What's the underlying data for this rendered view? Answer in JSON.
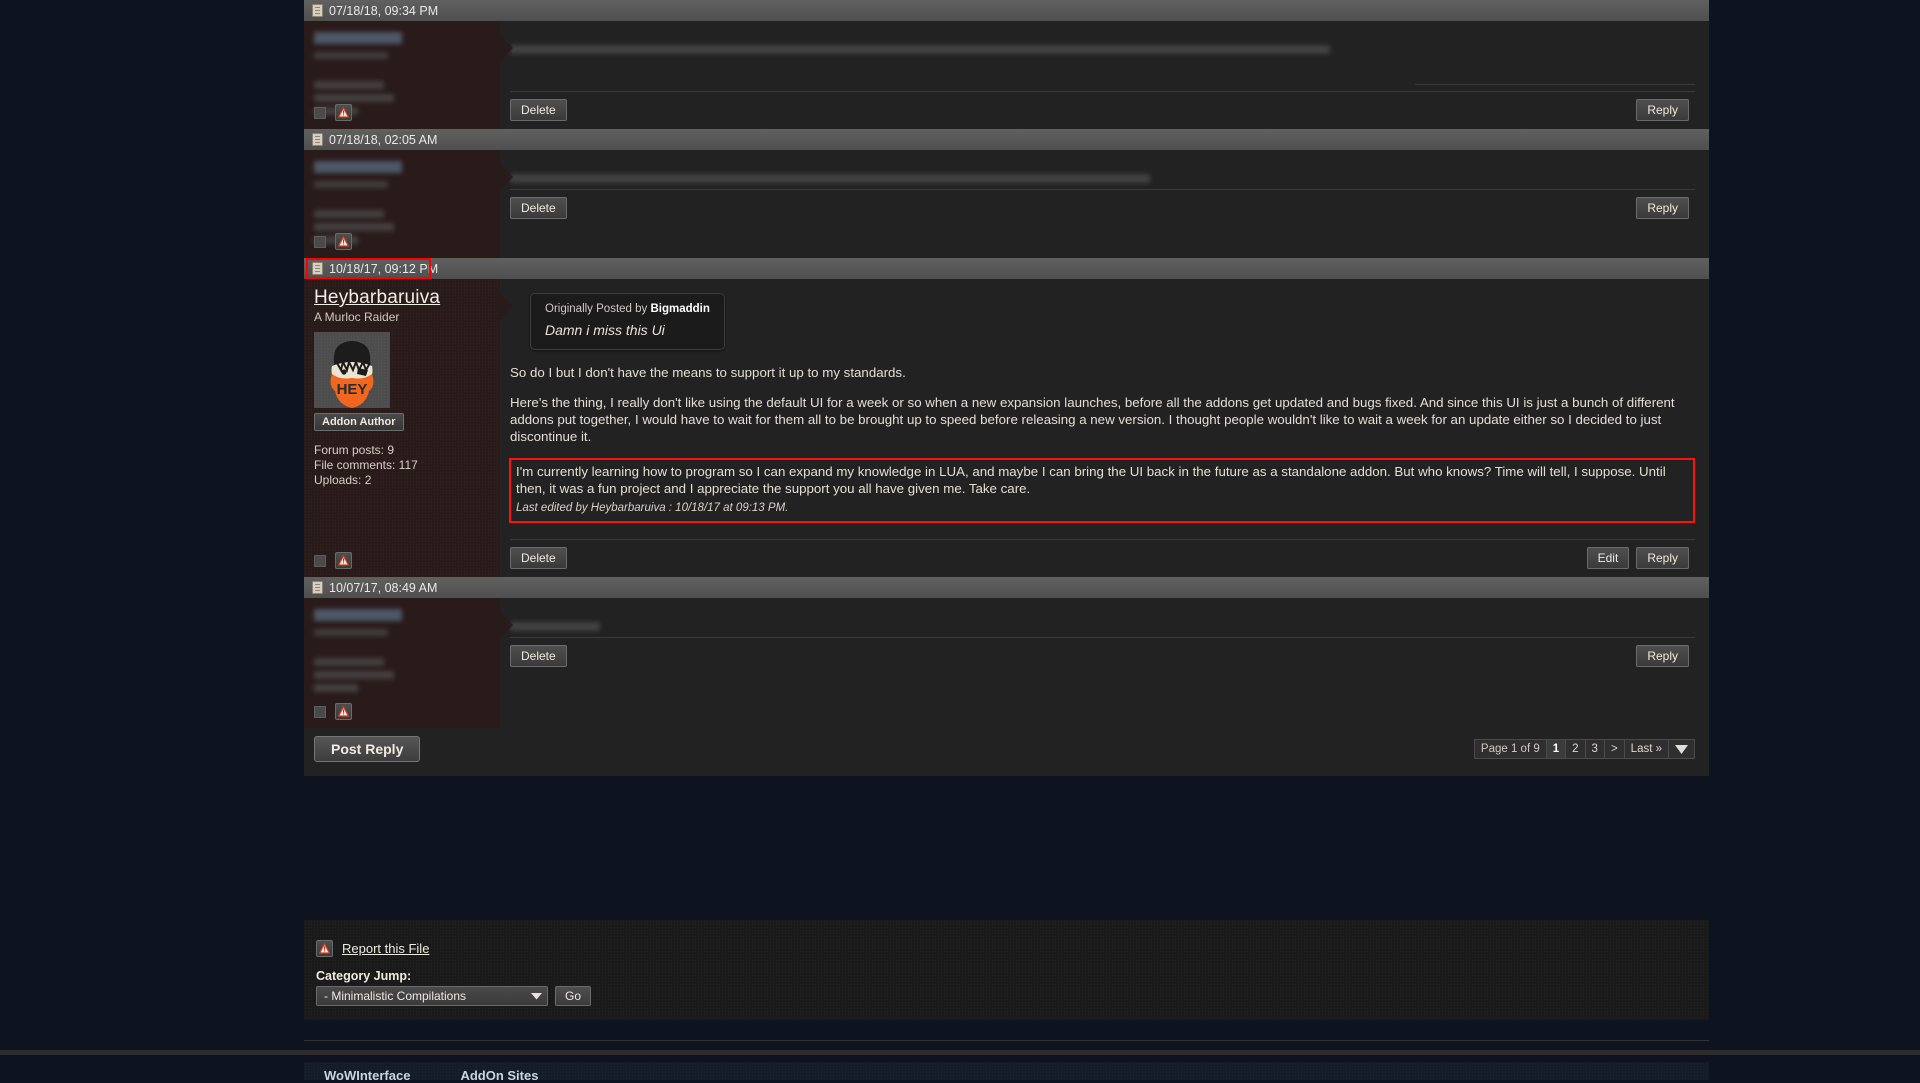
{
  "posts": [
    {
      "id": "post-1",
      "date": "07/18/18, 09:34 PM",
      "redacted": true,
      "delete_label": "Delete",
      "reply_label": "Reply"
    },
    {
      "id": "post-2",
      "date": "07/18/18, 02:05 AM",
      "redacted": true,
      "delete_label": "Delete",
      "reply_label": "Reply"
    },
    {
      "id": "post-3-highlighted",
      "date": "10/18/17, 09:12 PM",
      "redacted": false,
      "username": "Heybarbaruiva",
      "usertitle": "A Murloc Raider",
      "badge": "Addon Author",
      "stats": [
        "Forum posts: 9",
        "File comments: 117",
        "Uploads: 2"
      ],
      "quote": {
        "header_prefix": "Originally Posted by",
        "author": "Bigmaddin",
        "text": "Damn i miss this Ui"
      },
      "paragraphs": [
        "So do I but I don't have the means to support it up to my standards.",
        "Here's the thing, I really don't like using the default UI for a week or so when a new expansion launches, before all the addons get updated and bugs fixed. And since this UI is just a bunch of different addons put together, I would have to wait for them all to be brought up to speed before releasing a new version. I thought people wouldn't like to wait a week for an update either so I decided to just discontinue it."
      ],
      "highlighted_paragraph": "I'm currently learning how to program so I can expand my knowledge in LUA, and maybe I can bring the UI back in the future as a standalone addon. But who knows? Time will tell, I suppose. Until then, it was a fun project and I appreciate the support you all have given me. Take care.",
      "last_edited": "Last edited by Heybarbaruiva : 10/18/17 at 09:13 PM.",
      "delete_label": "Delete",
      "edit_label": "Edit",
      "reply_label": "Reply"
    },
    {
      "id": "post-4",
      "date": "10/07/17, 08:49 AM",
      "redacted": true,
      "delete_label": "Delete",
      "reply_label": "Reply"
    }
  ],
  "reply_bar": {
    "post_reply_label": "Post Reply",
    "pager": {
      "page_label": "Page 1 of 9",
      "pages": [
        "1",
        "2",
        "3"
      ],
      "next_label": ">",
      "last_label": "Last »"
    }
  },
  "footer": {
    "report_label": "Report this File",
    "category_jump_label": "Category Jump:",
    "category_selected": "- Minimalistic Compilations",
    "go_label": "Go"
  },
  "bottom_links": [
    "WoWInterface",
    "AddOn Sites"
  ],
  "colors": {
    "highlight": "#ff0000",
    "accent_orange": "#f2671f",
    "panel_bg": "#222222",
    "user_bg": "#2a1b1b",
    "page_bg": "#0d1420"
  }
}
